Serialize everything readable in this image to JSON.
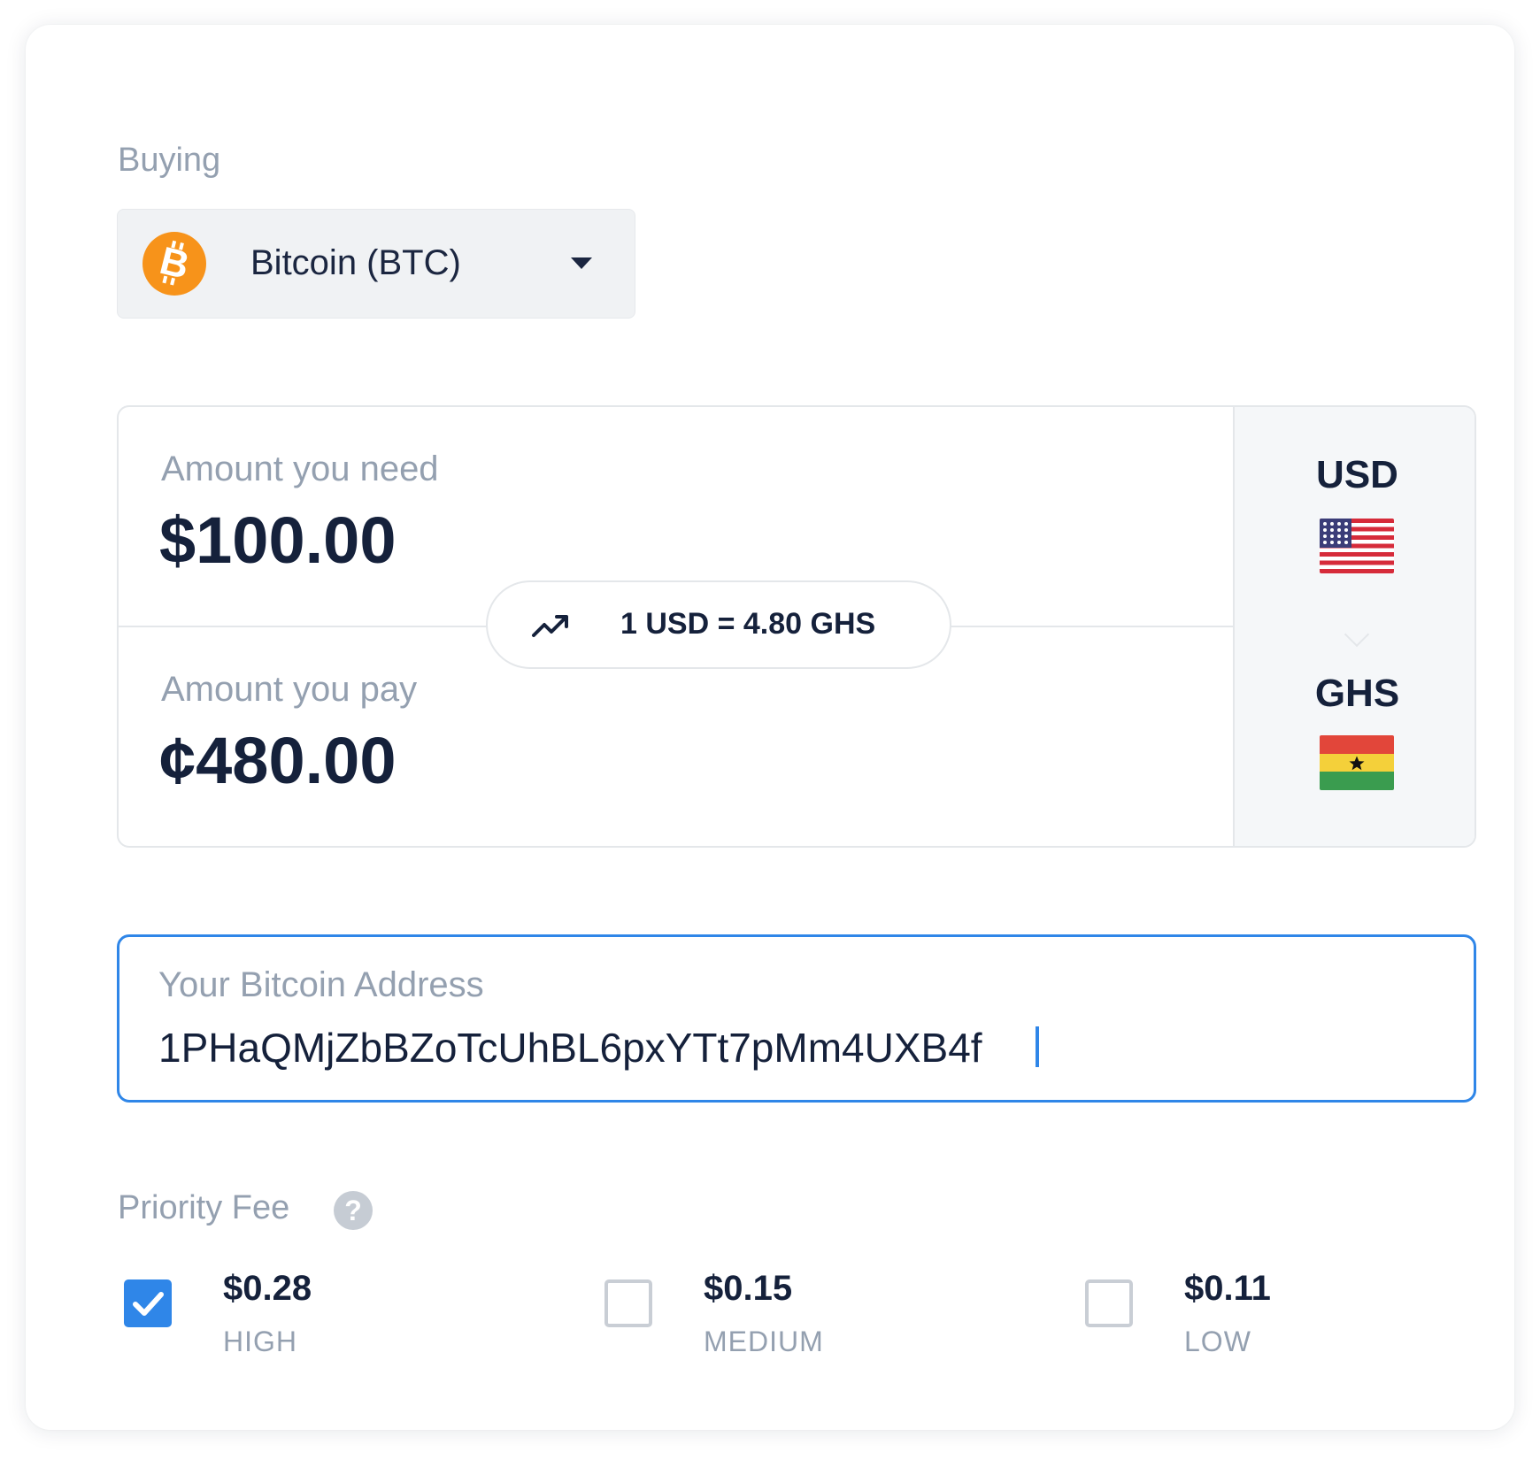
{
  "buying": {
    "label": "Buying",
    "coin": {
      "name": "Bitcoin (BTC)",
      "icon": "bitcoin-icon",
      "icon_color": "#f7931a"
    },
    "dropdown_icon": "caret-down-icon"
  },
  "amounts": {
    "need": {
      "label": "Amount you need",
      "value": "$100.00",
      "currency": "USD",
      "flag": "us-flag-icon"
    },
    "pay": {
      "label": "Amount you pay",
      "value": "¢480.00",
      "currency": "GHS",
      "flag": "ghana-flag-icon"
    },
    "rate": {
      "icon": "trending-up-icon",
      "text": "1 USD = 4.80 GHS"
    }
  },
  "address": {
    "label": "Your Bitcoin Address",
    "value": "1PHaQMjZbBZoTcUhBL6pxYTt7pMm4UXB4f"
  },
  "priority_fee": {
    "label": "Priority Fee",
    "help_icon": "question-mark-icon",
    "options": [
      {
        "amount": "$0.28",
        "level": "HIGH",
        "checked": true
      },
      {
        "amount": "$0.15",
        "level": "MEDIUM",
        "checked": false
      },
      {
        "amount": "$0.11",
        "level": "LOW",
        "checked": false
      }
    ]
  },
  "colors": {
    "accent": "#2f86e8",
    "text_dark": "#15213b",
    "text_muted": "#94a0b0",
    "bitcoin_orange": "#f7931a"
  }
}
